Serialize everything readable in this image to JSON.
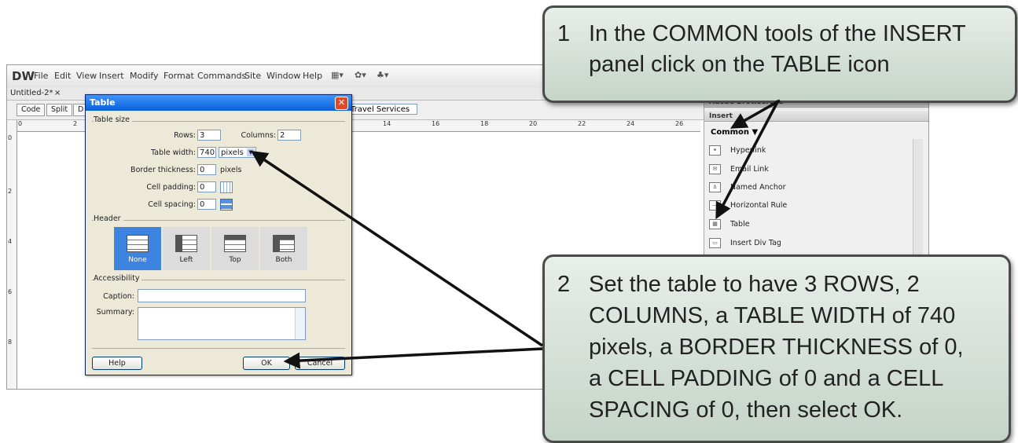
{
  "app": {
    "logo": "DW",
    "menu": [
      "File",
      "Edit",
      "View",
      "Insert",
      "Modify",
      "Format",
      "Commands",
      "Site",
      "Window",
      "Help"
    ],
    "doc_tab": "Untitled-2*",
    "doc_tab_close": "×",
    "view_buttons": [
      "Code",
      "Split",
      "D"
    ],
    "doc_title_field": "Travel Services",
    "ruler_h_numbers": [
      "0",
      "2",
      "14",
      "16",
      "18",
      "20",
      "22",
      "24",
      "26"
    ],
    "ruler_v_numbers": [
      "0",
      "2",
      "4",
      "6",
      "8"
    ]
  },
  "panel": {
    "browserlab_title": "Adobe BrowserLab",
    "insert_title": "Insert",
    "category": "Common",
    "category_arrow": "▼",
    "items": [
      "Hyperlink",
      "Email Link",
      "Named Anchor",
      "Horizontal Rule",
      "Table",
      "Insert Div Tag"
    ]
  },
  "dialog": {
    "title": "Table",
    "close": "✕",
    "section_table_size": "Table size",
    "rows_label": "Rows:",
    "rows_value": "3",
    "columns_label": "Columns:",
    "columns_value": "2",
    "width_label": "Table width:",
    "width_value": "740",
    "width_unit": "pixels",
    "border_label": "Border thickness:",
    "border_value": "0",
    "border_unit": "pixels",
    "padding_label": "Cell padding:",
    "padding_value": "0",
    "spacing_label": "Cell spacing:",
    "spacing_value": "0",
    "section_header": "Header",
    "header_options": [
      "None",
      "Left",
      "Top",
      "Both"
    ],
    "header_selected": "None",
    "section_accessibility": "Accessibility",
    "caption_label": "Caption:",
    "summary_label": "Summary:",
    "help_button": "Help",
    "ok_button": "OK",
    "cancel_button": "Cancel"
  },
  "callouts": {
    "step1_num": "1",
    "step1_line1": "In the COMMON tools of the INSERT",
    "step1_line2": "panel click on the TABLE icon",
    "step2_num": "2",
    "step2_lines": [
      "Set the table to have 3 ROWS, 2",
      "COLUMNS, a TABLE WIDTH of 740",
      "pixels, a BORDER THICKNESS of 0,",
      "a CELL PADDING of 0 and a CELL",
      "SPACING of 0, then select OK."
    ]
  },
  "colors": {
    "dialog_title_bar": "#0a5fd8",
    "selected_header": "#3d83e0",
    "callout_fill": "#d2ddd4"
  }
}
